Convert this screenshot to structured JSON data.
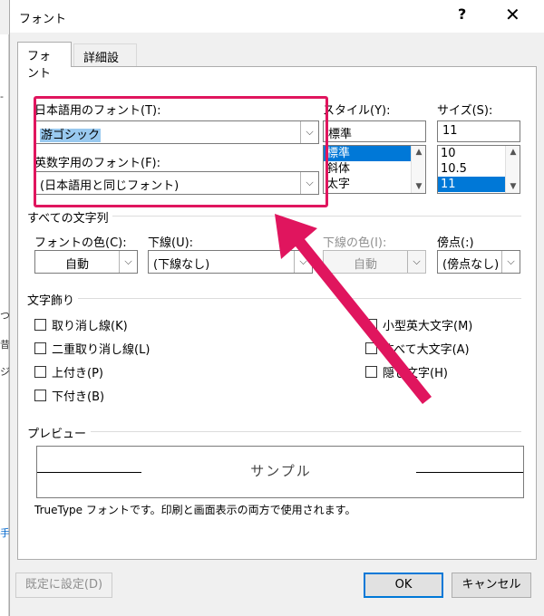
{
  "dialog": {
    "title": "フォント",
    "help_label": "?",
    "close_label": "✕",
    "tabs": [
      {
        "label": "フォント",
        "active": true
      },
      {
        "label": "詳細設定",
        "active": false
      }
    ]
  },
  "font": {
    "japanese_label": "日本語用のフォント(T):",
    "japanese_value": "游ゴシック",
    "english_label": "英数字用のフォント(F):",
    "english_value": "(日本語用と同じフォント)",
    "style_label": "スタイル(Y):",
    "style_value": "標準",
    "style_options": [
      "標準",
      "斜体",
      "太字"
    ],
    "size_label": "サイズ(S):",
    "size_value": "11",
    "size_options": [
      "10",
      "10.5",
      "11"
    ]
  },
  "all_text": {
    "group_title": "すべての文字列",
    "color_label": "フォントの色(C):",
    "color_value": "自動",
    "underline_label": "下線(U):",
    "underline_value": "(下線なし)",
    "underline_color_label": "下線の色(I):",
    "underline_color_value": "自動",
    "emphasis_label": "傍点(:)",
    "emphasis_value": "(傍点なし)"
  },
  "effects": {
    "group_title": "文字飾り",
    "left": [
      "取り消し線(K)",
      "二重取り消し線(L)",
      "上付き(P)",
      "下付き(B)"
    ],
    "right": [
      "小型英大文字(M)",
      "すべて大文字(A)",
      "隠し文字(H)"
    ]
  },
  "preview": {
    "group_title": "プレビュー",
    "sample": "サンプル",
    "note": "TrueType フォントです。印刷と画面表示の両方で使用されます。"
  },
  "buttons": {
    "set_default": "既定に設定(D)",
    "ok": "OK",
    "cancel": "キャンセル"
  },
  "background": {
    "fragments": [
      "-",
      "つ",
      "昔",
      "ジ",
      "手"
    ]
  },
  "colors": {
    "highlight": "#e0155e",
    "selection": "#0078d7",
    "text_selection": "#99c9ef"
  },
  "icons": {
    "dropdown": "chevron-down-icon",
    "scroll_up": "scroll-up-icon",
    "scroll_down": "scroll-down-icon",
    "annotation": "arrow-annotation"
  }
}
